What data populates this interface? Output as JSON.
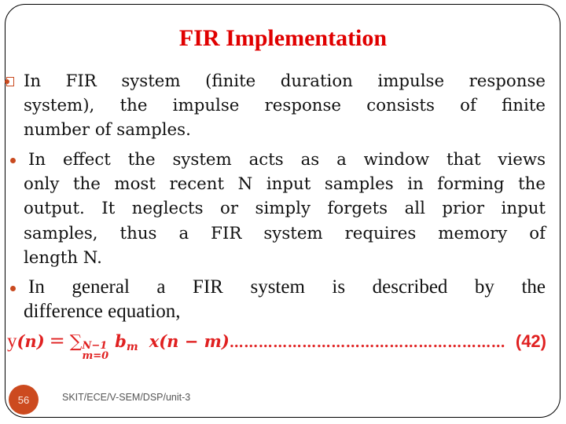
{
  "slide": {
    "title": "FIR Implementation",
    "bullets": [
      {
        "icon": "square-bullet-icon",
        "lines": [
          "In FIR system (finite duration impulse response",
          "system), the impulse response consists of finite",
          "number of samples."
        ]
      },
      {
        "icon": "dot-bullet-icon",
        "lines": [
          "In effect the system acts as a window that views",
          "only the most recent N input samples in forming the",
          "output. It neglects or simply forgets all prior input",
          "samples, thus a FIR system requires memory of",
          "length N."
        ]
      },
      {
        "icon": "dot-bullet-icon",
        "lines": [
          "In general a FIR system is described by the",
          "difference equation,"
        ]
      }
    ],
    "equation": {
      "lhs_func": "y",
      "lhs_arg": "(n)",
      "equals": "=",
      "sum_symbol": "∑",
      "upper_limit": "N−1",
      "lower_limit": "m=0",
      "coef": "b",
      "coef_sub": "m",
      "term": "x(n − m)",
      "dots": "…………………………………………………",
      "number": "(42)"
    },
    "page_number": "56",
    "footer_text": "SKIT/ECE/V-SEM/DSP/unit-3",
    "colors": {
      "title": "#e00000",
      "accent": "#cc4a1f",
      "equation": "#e02020"
    }
  }
}
